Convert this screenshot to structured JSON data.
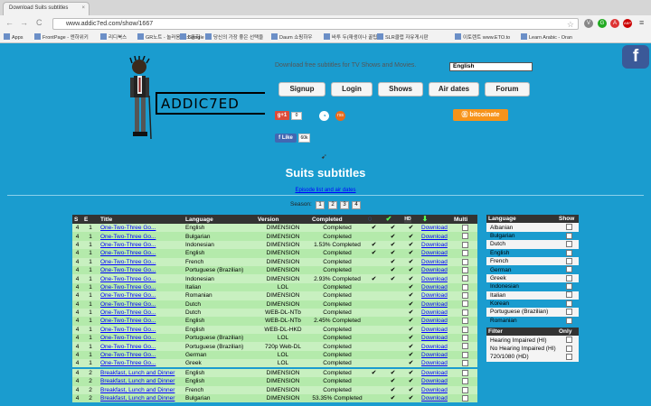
{
  "browser": {
    "tab_title": "Download Suits subtitles",
    "tab_close": "×",
    "url": "www.addic7ed.com/show/1667",
    "bookmarks": [
      "Apps",
      "FrontPage - 엔하위키",
      "리디북스",
      "GR노트 - 놀러옴을 소중히",
      "Google",
      "당신의 가장 좋은 선택을",
      "Daum 쇼핑하우",
      "바투 두(재생이나 꿀팁)",
      "SLR클럽 자유게시판",
      "이토렌트 www.ETO.to",
      "Learn Arabic - Oran"
    ],
    "nav": {
      "back": "←",
      "forward": "→",
      "reload": "C",
      "star": "☆",
      "menu": "≡"
    },
    "extensions": [
      "V",
      "G",
      "A",
      "ABP"
    ]
  },
  "site": {
    "logo": "ADDIC7ED",
    "tagline": "Download free subtitles for TV Shows and Movies.",
    "language_select": "English",
    "facebook_icon": "f",
    "nav_buttons": [
      "Signup",
      "Login",
      "Shows",
      "Air dates",
      "Forum"
    ],
    "gplus_label": "g+1",
    "gplus_count": "0",
    "fb_like_label": "f Like",
    "fb_like_count": "60k",
    "bitcoin_label": "Ⓑ bitcoinate",
    "icon_a": "◔",
    "icon_b": "rss"
  },
  "page": {
    "title": "Suits subtitles",
    "episode_link": "Episode list and air dates",
    "season_label": "Season:",
    "seasons": [
      "1",
      "2",
      "3",
      "4"
    ]
  },
  "main_table": {
    "headers": [
      "S",
      "E",
      "Title",
      "Language",
      "Version",
      "Completed",
      "",
      "",
      "",
      "",
      "Multi"
    ],
    "header_icons": [
      "hi-icon",
      "corrected-icon",
      "hd-icon",
      "download-icon"
    ],
    "check": "✔",
    "rows": [
      {
        "s": "4",
        "e": "1",
        "title": "One-Two-Three Go...",
        "language": "English",
        "version": "DIMENSION",
        "completed": "Completed",
        "c1": true,
        "c2": true,
        "c3": true,
        "download": "Download",
        "group": "a"
      },
      {
        "s": "4",
        "e": "1",
        "title": "One-Two-Three Go...",
        "language": "Bulgarian",
        "version": "DIMENSION",
        "completed": "Completed",
        "c1": false,
        "c2": true,
        "c3": true,
        "download": "Download",
        "group": "b"
      },
      {
        "s": "4",
        "e": "1",
        "title": "One-Two-Three Go...",
        "language": "Indonesian",
        "version": "DIMENSION",
        "completed": "1.53% Completed",
        "c1": true,
        "c2": true,
        "c3": true,
        "download": "Download",
        "group": "a"
      },
      {
        "s": "4",
        "e": "1",
        "title": "One-Two-Three Go...",
        "language": "English",
        "version": "DIMENSION",
        "completed": "Completed",
        "c1": true,
        "c2": true,
        "c3": true,
        "download": "Download",
        "group": "b"
      },
      {
        "s": "4",
        "e": "1",
        "title": "One-Two-Three Go...",
        "language": "French",
        "version": "DIMENSION",
        "completed": "Completed",
        "c1": false,
        "c2": true,
        "c3": true,
        "download": "Download",
        "group": "a"
      },
      {
        "s": "4",
        "e": "1",
        "title": "One-Two-Three Go...",
        "language": "Portuguese (Brazilian)",
        "version": "DIMENSION",
        "completed": "Completed",
        "c1": false,
        "c2": true,
        "c3": true,
        "download": "Download",
        "group": "b"
      },
      {
        "s": "4",
        "e": "1",
        "title": "One-Two-Three Go...",
        "language": "Indonesian",
        "version": "DIMENSION",
        "completed": "2.93% Completed",
        "c1": true,
        "c2": true,
        "c3": true,
        "download": "Download",
        "group": "a"
      },
      {
        "s": "4",
        "e": "1",
        "title": "One-Two-Three Go...",
        "language": "Italian",
        "version": "LOL",
        "completed": "Completed",
        "c1": false,
        "c2": false,
        "c3": true,
        "download": "Download",
        "group": "b"
      },
      {
        "s": "4",
        "e": "1",
        "title": "One-Two-Three Go...",
        "language": "Romanian",
        "version": "DIMENSION",
        "completed": "Completed",
        "c1": false,
        "c2": false,
        "c3": true,
        "download": "Download",
        "group": "a"
      },
      {
        "s": "4",
        "e": "1",
        "title": "One-Two-Three Go...",
        "language": "Dutch",
        "version": "DIMENSION",
        "completed": "Completed",
        "c1": false,
        "c2": false,
        "c3": true,
        "download": "Download",
        "group": "b"
      },
      {
        "s": "4",
        "e": "1",
        "title": "One-Two-Three Go...",
        "language": "Dutch",
        "version": "WEB-DL-NTb",
        "completed": "Completed",
        "c1": false,
        "c2": false,
        "c3": true,
        "download": "Download",
        "group": "a"
      },
      {
        "s": "4",
        "e": "1",
        "title": "One-Two-Three Go...",
        "language": "English",
        "version": "WEB-DL-NTb",
        "completed": "2.45% Completed",
        "c1": false,
        "c2": false,
        "c3": true,
        "download": "Download",
        "group": "b"
      },
      {
        "s": "4",
        "e": "1",
        "title": "One-Two-Three Go...",
        "language": "English",
        "version": "WEB-DL-HKD",
        "completed": "Completed",
        "c1": false,
        "c2": false,
        "c3": true,
        "download": "Download",
        "group": "a"
      },
      {
        "s": "4",
        "e": "1",
        "title": "One-Two-Three Go...",
        "language": "Portuguese (Brazilian)",
        "version": "LOL",
        "completed": "Completed",
        "c1": false,
        "c2": false,
        "c3": true,
        "download": "Download",
        "group": "b"
      },
      {
        "s": "4",
        "e": "1",
        "title": "One-Two-Three Go...",
        "language": "Portuguese (Brazilian)",
        "version": "720p Web-DL",
        "completed": "Completed",
        "c1": false,
        "c2": false,
        "c3": true,
        "download": "Download",
        "group": "a"
      },
      {
        "s": "4",
        "e": "1",
        "title": "One-Two-Three Go...",
        "language": "German",
        "version": "LOL",
        "completed": "Completed",
        "c1": false,
        "c2": false,
        "c3": true,
        "download": "Download",
        "group": "b"
      },
      {
        "s": "4",
        "e": "1",
        "title": "One-Two-Three Go...",
        "language": "Greek",
        "version": "LOL",
        "completed": "Completed",
        "c1": false,
        "c2": false,
        "c3": true,
        "download": "Download",
        "group": "a"
      },
      {
        "s": "4",
        "e": "2",
        "title": "Breakfast, Lunch and Dinner",
        "language": "English",
        "version": "DIMENSION",
        "completed": "Completed",
        "c1": true,
        "c2": true,
        "c3": true,
        "download": "Download",
        "group": "a",
        "sep": true
      },
      {
        "s": "4",
        "e": "2",
        "title": "Breakfast, Lunch and Dinner",
        "language": "English",
        "version": "DIMENSION",
        "completed": "Completed",
        "c1": false,
        "c2": true,
        "c3": true,
        "download": "Download",
        "group": "b"
      },
      {
        "s": "4",
        "e": "2",
        "title": "Breakfast, Lunch and Dinner",
        "language": "French",
        "version": "DIMENSION",
        "completed": "Completed",
        "c1": false,
        "c2": true,
        "c3": true,
        "download": "Download",
        "group": "a"
      },
      {
        "s": "4",
        "e": "2",
        "title": "Breakfast, Lunch and Dinner",
        "language": "Bulgarian",
        "version": "DIMENSION",
        "completed": "53.35% Completed",
        "c1": false,
        "c2": true,
        "c3": true,
        "download": "Download",
        "group": "b"
      }
    ]
  },
  "side_table": {
    "language_header": "Language",
    "show_header": "Show",
    "languages": [
      {
        "name": "Albanian",
        "style": "w"
      },
      {
        "name": "Bulgarian",
        "style": "blue"
      },
      {
        "name": "Dutch",
        "style": "w"
      },
      {
        "name": "English",
        "style": "blue"
      },
      {
        "name": "French",
        "style": "w"
      },
      {
        "name": "German",
        "style": "blue"
      },
      {
        "name": "Greek",
        "style": "w"
      },
      {
        "name": "Indonesian",
        "style": "blue"
      },
      {
        "name": "Italian",
        "style": "w"
      },
      {
        "name": "Korean",
        "style": "blue"
      },
      {
        "name": "Portuguese (Brazilian)",
        "style": "w"
      },
      {
        "name": "Romanian",
        "style": "blue"
      }
    ],
    "filter_header": "Filter",
    "only_header": "Only",
    "filters": [
      "Hearing Impaired (HI)",
      "No Hearing Impaired (HI)",
      "720/1080 (HD)"
    ]
  }
}
